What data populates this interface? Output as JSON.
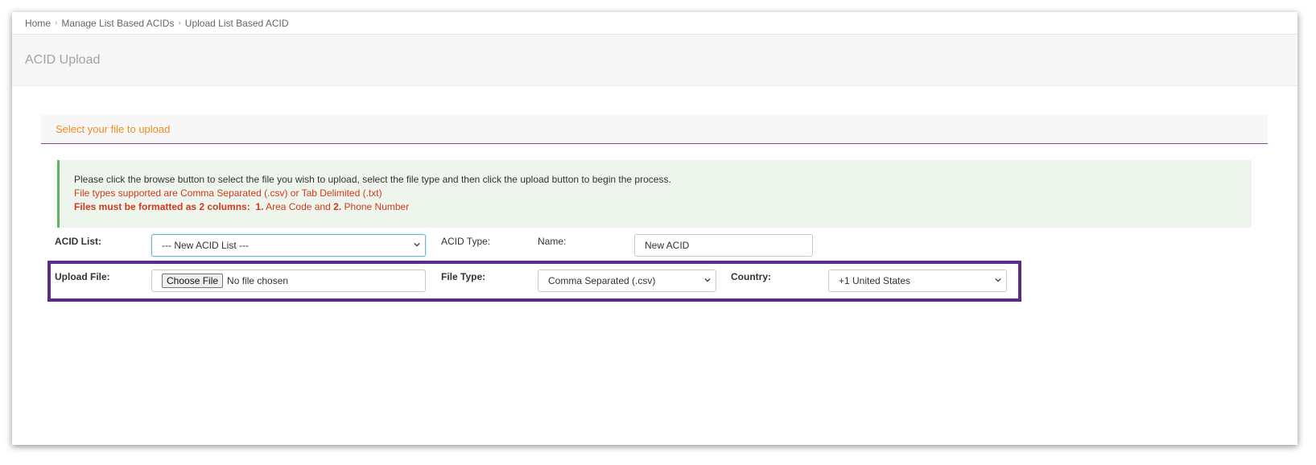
{
  "breadcrumb": {
    "items": [
      "Home",
      "Manage List Based ACIDs",
      "Upload List Based ACID"
    ]
  },
  "page": {
    "title": "ACID Upload"
  },
  "panel": {
    "title": "Select your file to upload",
    "instructions": "Please click the browse button to select the file you wish to upload, select the file type and then click the upload button to begin the process.",
    "supported": "File types supported are Comma Separated (.csv) or Tab Delimited (.txt)",
    "format_bold": "Files must be formatted as 2 columns:",
    "col1_num": "1.",
    "col1_text": "Area Code and",
    "col2_num": "2.",
    "col2_text": "Phone Number"
  },
  "form": {
    "acid_list_label": "ACID List:",
    "acid_list_value": "--- New ACID List ---",
    "acid_type_label": "ACID Type:",
    "name_label": "Name:",
    "name_value": "New ACID",
    "upload_file_label": "Upload File:",
    "choose_file_button": "Choose File",
    "no_file_text": "No file chosen",
    "file_type_label": "File Type:",
    "file_type_value": "Comma Separated (.csv)",
    "country_label": "Country:",
    "country_value": "+1 United States"
  },
  "colors": {
    "accent_orange": "#f28c1e",
    "alert_red": "#d2391e",
    "highlight_purple": "#5a2a8c",
    "alert_green": "#5cb85c"
  }
}
